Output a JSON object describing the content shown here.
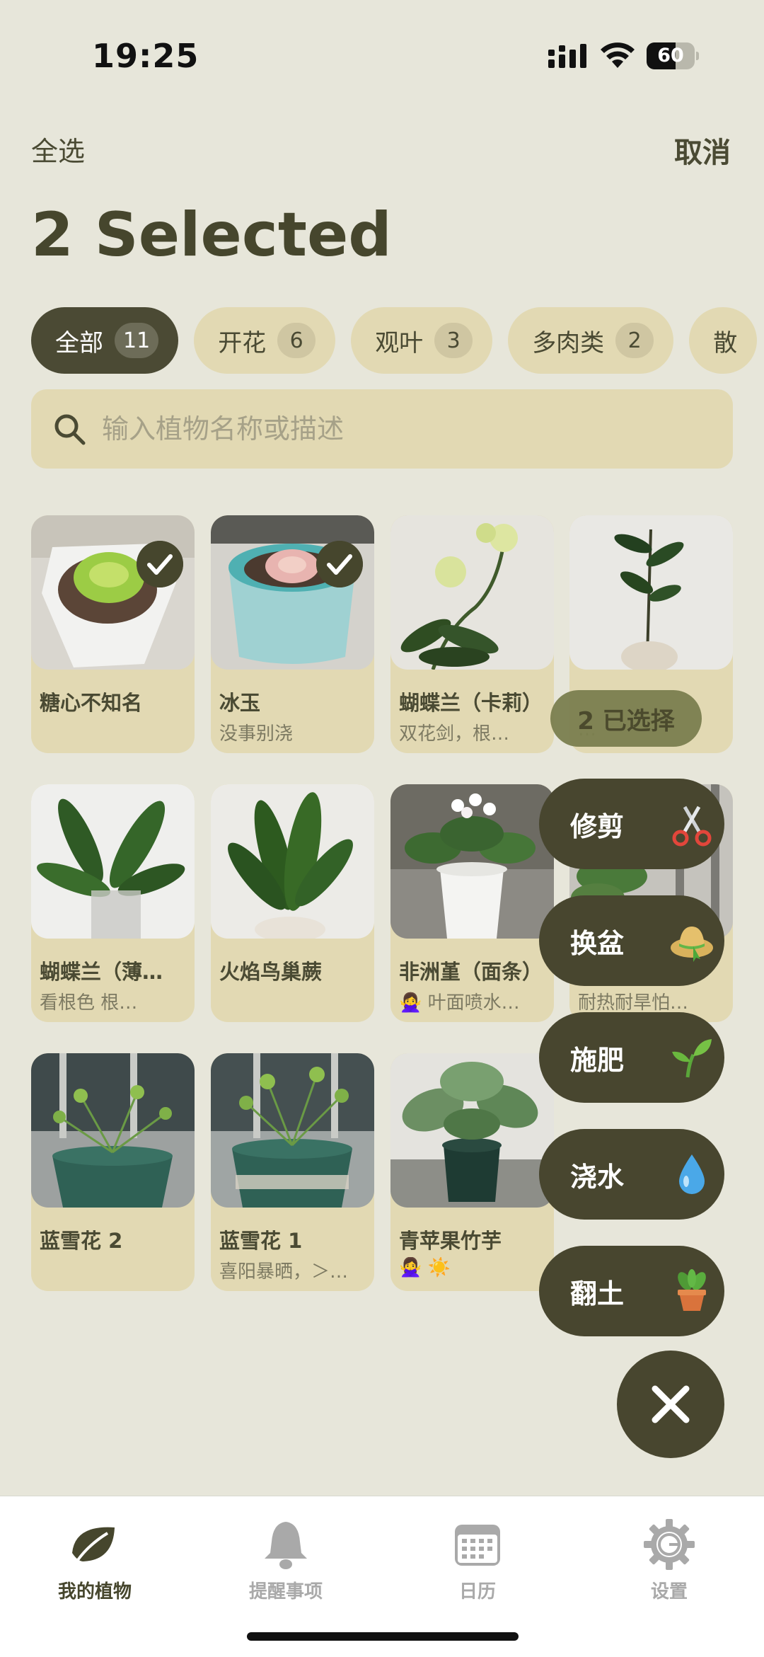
{
  "status": {
    "time": "19:25",
    "battery": "60",
    "battery_level": 0.6
  },
  "header": {
    "select_all": "全选",
    "cancel": "取消",
    "title": "2 Selected"
  },
  "chips": [
    {
      "label": "全部",
      "count": "11"
    },
    {
      "label": "开花",
      "count": "6"
    },
    {
      "label": "观叶",
      "count": "3"
    },
    {
      "label": "多肉类",
      "count": "2"
    },
    {
      "label": "散",
      "count": ""
    }
  ],
  "search": {
    "placeholder": "输入植物名称或描述",
    "value": ""
  },
  "plants": [
    {
      "name": "糖心不知名",
      "desc": "",
      "selected": true
    },
    {
      "name": "冰玉",
      "desc": "没事别浇",
      "selected": true
    },
    {
      "name": "蝴蝶兰（卡莉）",
      "desc": "双花剑，根…",
      "selected": false
    },
    {
      "name": "",
      "desc": "…",
      "selected": false
    },
    {
      "name": "蝴蝶兰（薄…",
      "desc": "看根色 根…",
      "selected": false
    },
    {
      "name": "火焰鸟巢蕨",
      "desc": "",
      "selected": false
    },
    {
      "name": "非洲堇（面条）",
      "desc": "🙅‍♀️ 叶面喷水…",
      "selected": false
    },
    {
      "name": "",
      "desc": "耐热耐旱怕…",
      "selected": false
    },
    {
      "name": "蓝雪花 2",
      "desc": "",
      "selected": false
    },
    {
      "name": "蓝雪花 1",
      "desc": "喜阳暴晒，＞…",
      "selected": false
    },
    {
      "name": "青苹果竹芋",
      "desc": "🙅‍♀️ ☀️",
      "selected": false
    }
  ],
  "selected_pill": "2 已选择",
  "actions": [
    {
      "label": "修剪",
      "icon": "scissors-icon"
    },
    {
      "label": "换盆",
      "icon": "straw-hat-icon"
    },
    {
      "label": "施肥",
      "icon": "seedling-icon"
    },
    {
      "label": "浇水",
      "icon": "water-drop-icon"
    },
    {
      "label": "翻土",
      "icon": "potted-plant-icon"
    }
  ],
  "tabs": [
    {
      "label": "我的植物",
      "icon": "leaf-icon"
    },
    {
      "label": "提醒事项",
      "icon": "bell-icon"
    },
    {
      "label": "日历",
      "icon": "calendar-icon"
    },
    {
      "label": "设置",
      "icon": "gear-icon"
    }
  ],
  "colors": {
    "background": "#e7e6da",
    "card": "#e2d9b3",
    "accent": "#4b4a34",
    "inactive_tab": "#a9a9a9"
  }
}
